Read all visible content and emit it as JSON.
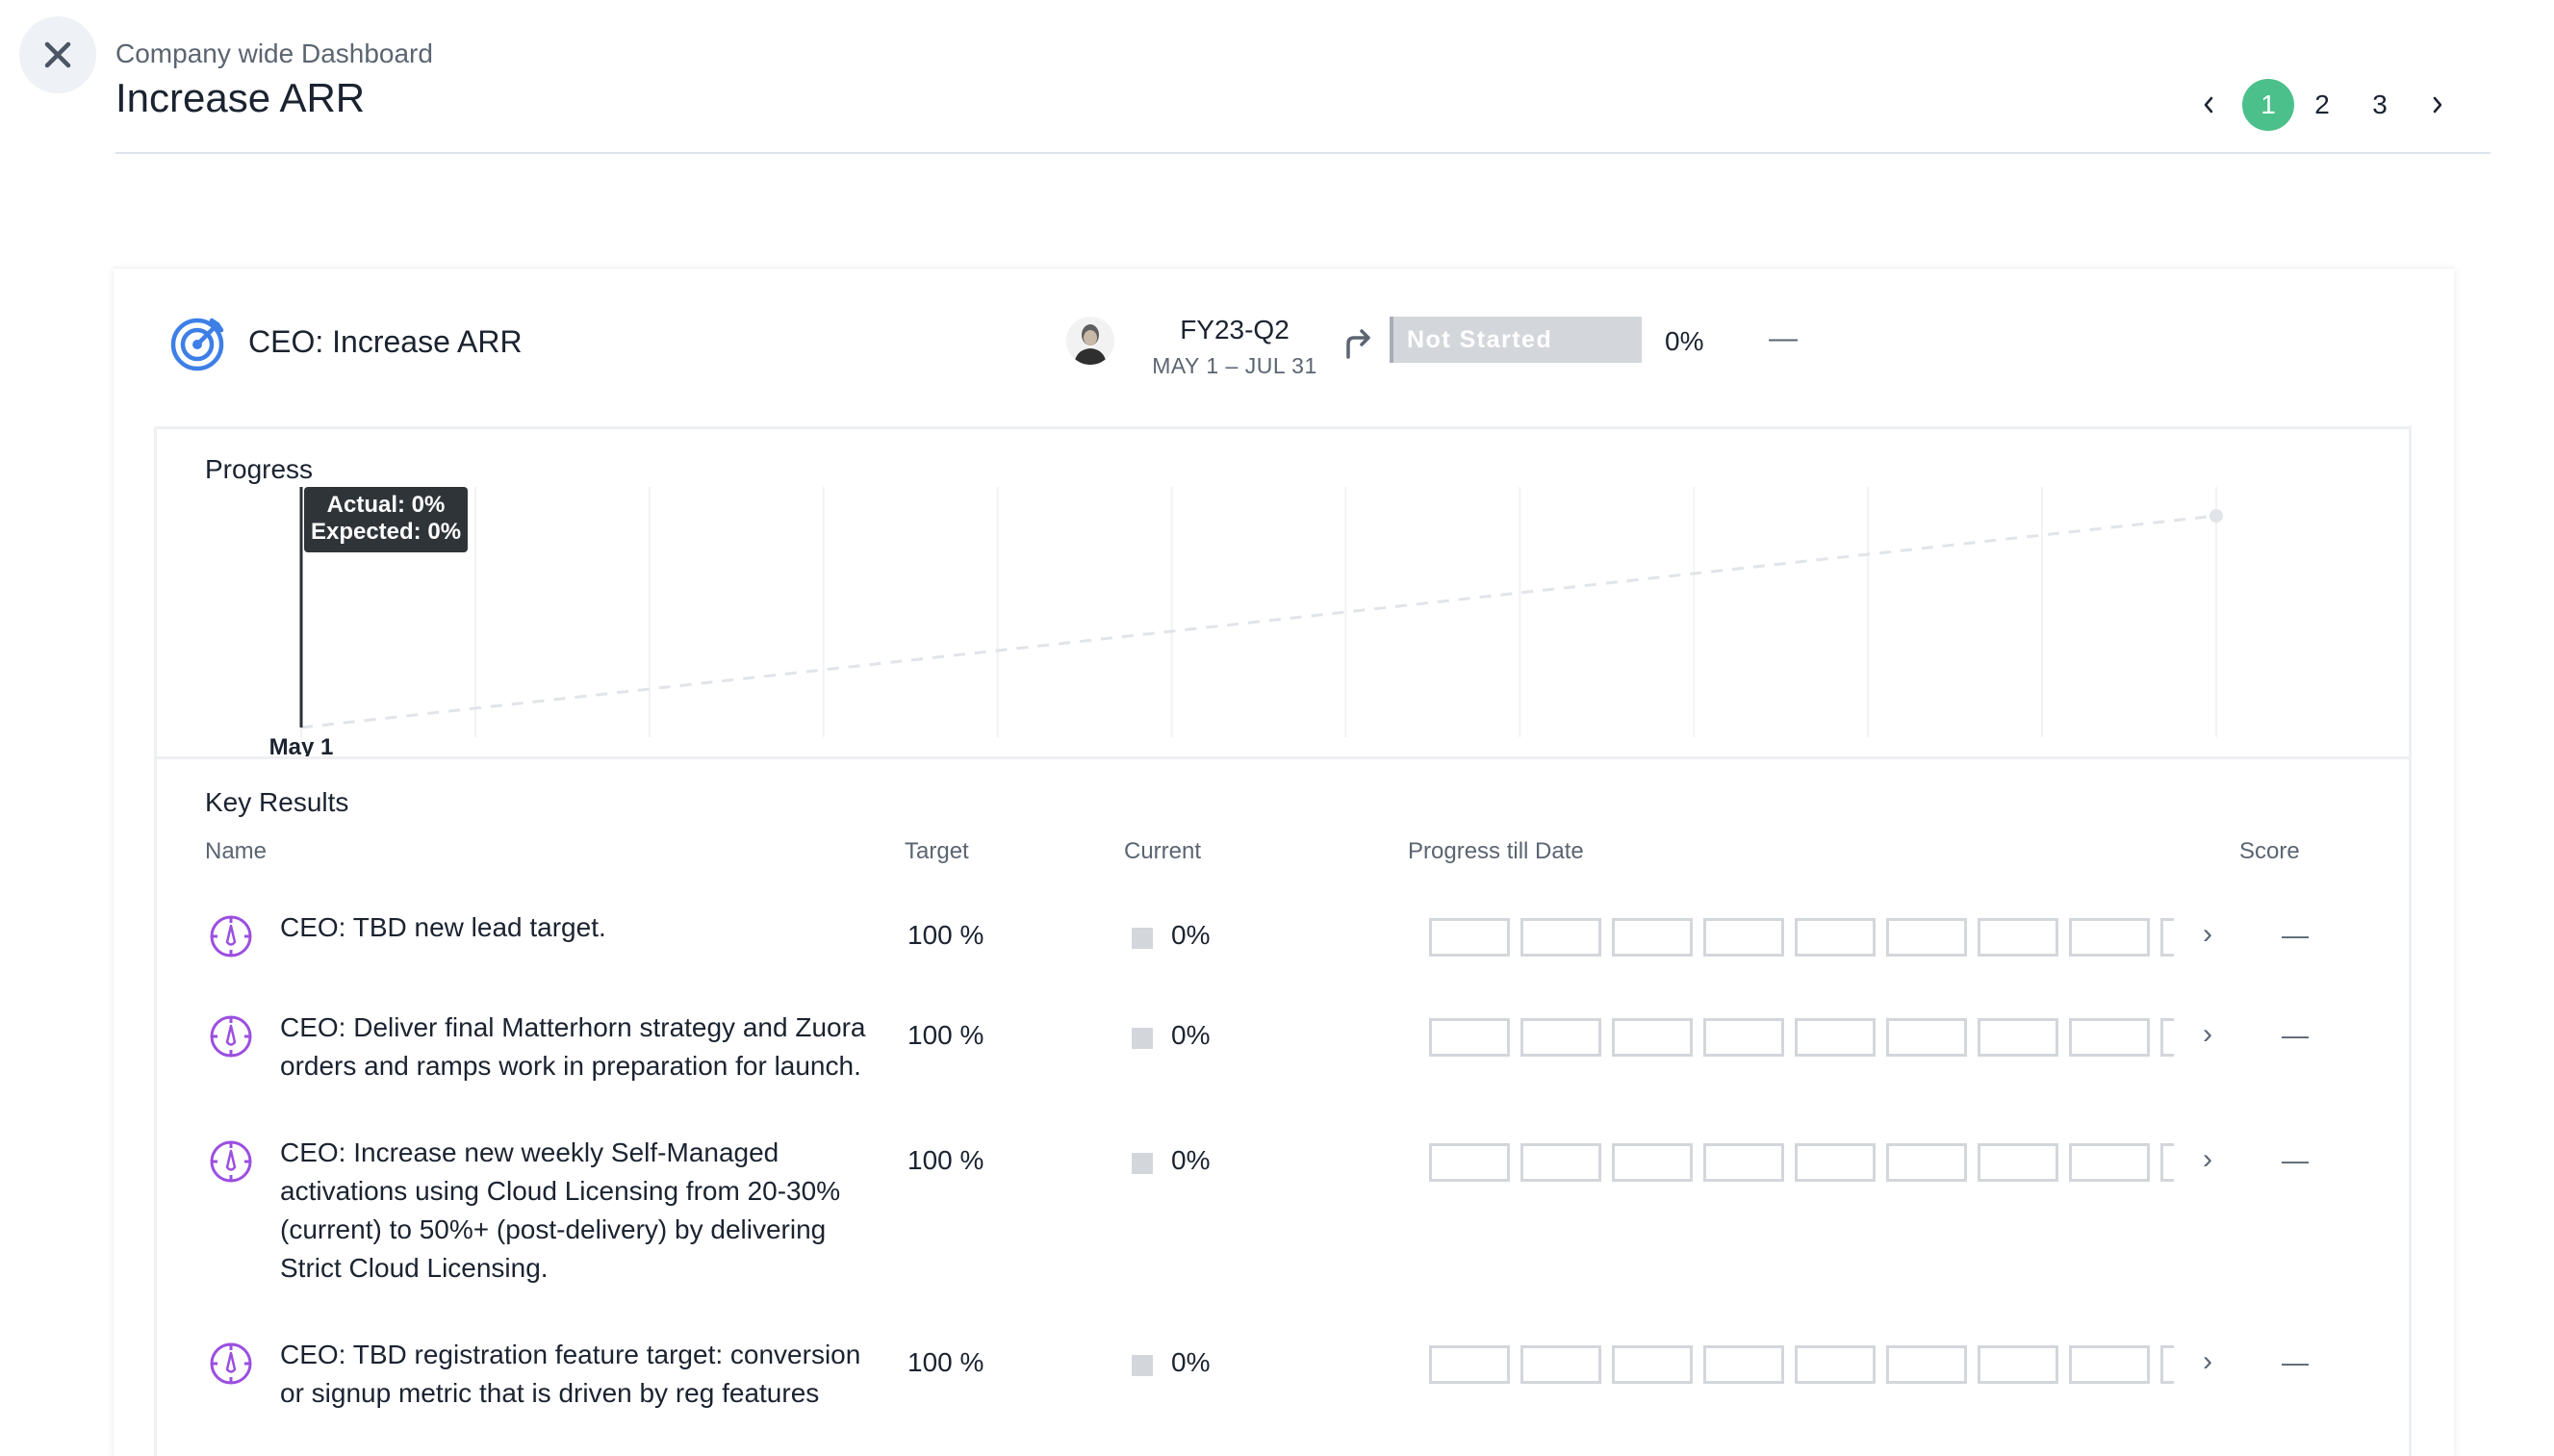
{
  "header": {
    "breadcrumb": "Company wide Dashboard",
    "title": "Increase ARR"
  },
  "pagination": {
    "prev": "‹",
    "pages": [
      "1",
      "2",
      "3"
    ],
    "active_page": "1",
    "next": "›"
  },
  "objective": {
    "title": "CEO: Increase ARR",
    "period": "FY23-Q2",
    "dates": "MAY 1 – JUL 31",
    "status": "Not Started",
    "progress": "0%",
    "score": "—"
  },
  "progress_section": {
    "label": "Progress",
    "tooltip_actual": "Actual: 0%",
    "tooltip_expected": "Expected: 0%"
  },
  "chart_data": {
    "type": "line",
    "title": "",
    "xlabel": "",
    "ylabel": "",
    "x_tick_labels": [
      "May 1"
    ],
    "series": [
      {
        "values": [
          0
        ],
        "style": "solid"
      },
      {
        "values": [
          0,
          100
        ],
        "style": "dashed"
      }
    ],
    "ylim": [
      0,
      100
    ],
    "grid": true
  },
  "key_results": {
    "label": "Key Results",
    "columns": {
      "name": "Name",
      "target": "Target",
      "current": "Current",
      "progress": "Progress till Date",
      "score": "Score"
    },
    "rows": [
      {
        "name": "CEO: TBD new lead target.",
        "target": "100 %",
        "current": "0%",
        "score": "—"
      },
      {
        "name": "CEO: Deliver final Matterhorn strategy and Zuora orders and ramps work in preparation for launch.",
        "target": "100 %",
        "current": "0%",
        "score": "—"
      },
      {
        "name": "CEO: Increase new weekly Self-Managed activations using Cloud Licensing from 20-30% (current) to 50%+ (post-delivery) by delivering Strict Cloud Licensing.",
        "target": "100 %",
        "current": "0%",
        "score": "—"
      },
      {
        "name": "CEO: TBD registration feature target: conversion or signup metric that is driven by reg features",
        "target": "100 %",
        "current": "0%",
        "score": "—"
      }
    ]
  },
  "colors": {
    "accent_green": "#4cc08a",
    "objective_icon": "#3d7fe6",
    "key_result_icon": "#9b4fe0",
    "status_grey": "#d3d6db"
  }
}
